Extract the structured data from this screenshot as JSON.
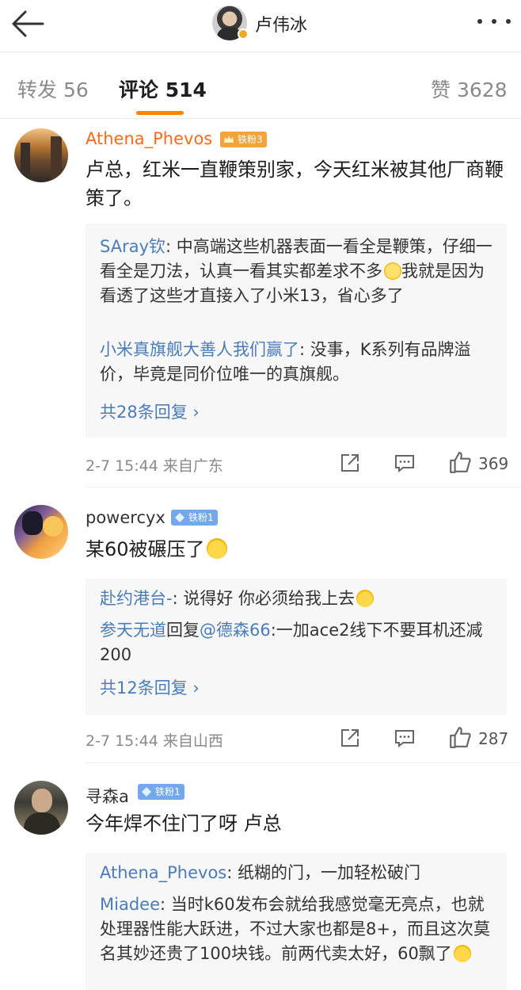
{
  "header": {
    "name": "卢伟冰",
    "back_icon": "arrow-left-icon",
    "more_icon": "more-dots-icon",
    "verified_color": "#f5a623"
  },
  "tabs": {
    "repost": "转发 56",
    "comments": "评论 514",
    "likes": "赞 3628",
    "accent": "#ff8200"
  },
  "comments": [
    {
      "username": "Athena_Phevos",
      "badge": "铁粉3",
      "text": "卢总，红米一直鞭策别家，今天红米被其他厂商鞭策了。",
      "replies": [
        {
          "name": "SAray钦",
          "text": ": 中高端这些机器表面一看全是鞭策，仔细一看全是刀法，认真一看其实都差求不多",
          "text2": "我就是因为看透了这些才直接入了小米13，省心多了"
        },
        {
          "name": "小米真旗舰大善人我们赢了",
          "text": ": 没事，K系列有品牌溢价，毕竟是同价位唯一的真旗舰。"
        }
      ],
      "more_replies": "共28条回复 ›",
      "time": "2-7 15:44 来自广东",
      "likes": "369"
    },
    {
      "username": "powercyx",
      "badge": "铁粉1",
      "text": "某60被碾压了",
      "replies": [
        {
          "name": "赴约港台-",
          "text": ": 说得好 你必须给我上去"
        },
        {
          "name": "参天无道",
          "mid": "回复",
          "name2": "@德森66",
          "text": ":一加ace2线下不要耳机还减200"
        }
      ],
      "more_replies": "共12条回复 ›",
      "time": "2-7 15:44 来自山西",
      "likes": "287"
    },
    {
      "username": "寻森a",
      "badge": "铁粉1",
      "text": "今年焊不住门了呀 卢总",
      "replies": [
        {
          "name": "Athena_Phevos",
          "text": ": 纸糊的门，一加轻松破门"
        },
        {
          "name": "Miadee",
          "text": ": 当时k60发布会就给我感觉毫无亮点，也就处理器性能大跃进，不过大家也都是8+，而且这次莫名其妙还贵了100块钱。前两代卖太好，60飘了"
        }
      ]
    }
  ],
  "colors": {
    "orange_name": "#f86a1c",
    "link_blue": "#4a7cb8",
    "gold_badge": "#f0a43a",
    "blue_badge": "#73a8ea"
  }
}
